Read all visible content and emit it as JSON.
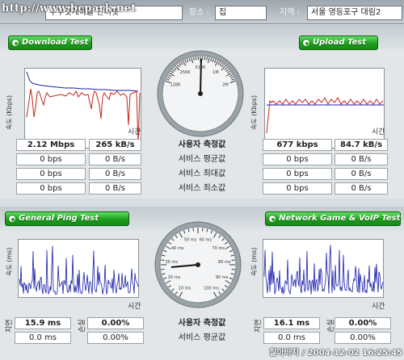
{
  "watermark": "http://www.bcpark.net",
  "topbar": {
    "service_value": "주무엇게하을 인터넷",
    "location_label": "장소 :",
    "location_value": "집",
    "region_label": "지역 :",
    "region_value": "서울 영등포구 대림2"
  },
  "download": {
    "title": "Download Test",
    "y_axis": "속도 (Kbps)",
    "x_axis": "시간",
    "rows": [
      [
        "2.12 Mbps",
        "265 kB/s"
      ],
      [
        "0 bps",
        "0 B/s"
      ],
      [
        "0 bps",
        "0 B/s"
      ],
      [
        "0 bps",
        "0 B/s"
      ]
    ]
  },
  "upload": {
    "title": "Upload Test",
    "y_axis": "속도 (Kbps)",
    "x_axis": "시간",
    "rows": [
      [
        "677 kbps",
        "84.7 kB/s"
      ],
      [
        "0 bps",
        "0 B/s"
      ],
      [
        "0 bps",
        "0 B/s"
      ],
      [
        "0 bps",
        "0 B/s"
      ]
    ]
  },
  "center_top": {
    "labels": [
      "사용자 측정값",
      "서비스 평균값",
      "서비스 최대값",
      "서비스 최소값"
    ]
  },
  "ping": {
    "title": "General Ping Test",
    "y_axis": "속도 (ms)",
    "x_axis": "시간",
    "side_label_left": "지연",
    "side_label_right": "손실",
    "rows": [
      [
        "15.9 ms",
        "0.00%"
      ],
      [
        "0.0 ms",
        "0.00%"
      ]
    ]
  },
  "game": {
    "title": "Network Game & VoIP Test",
    "y_axis": "속도 (ms)",
    "x_axis": "시간",
    "side_label_left": "지연",
    "side_label_right": "손실",
    "rows": [
      [
        "16.1 ms",
        "0.00%"
      ],
      [
        "0.0 ms",
        "0.00%"
      ]
    ]
  },
  "center_bottom": {
    "labels": [
      "사용자 측정값",
      "서비스 평균값"
    ]
  },
  "gauge_top": {
    "tick_labels": [
      "128K",
      "256K",
      "512K",
      "1M",
      "2M"
    ]
  },
  "gauge_bottom": {
    "tick_labels": [
      "10 ms",
      "20 ms",
      "30 ms",
      "40 ms",
      "50 ms",
      "60 ms",
      "70 ms",
      "80 ms",
      "90 ms",
      "100 ms"
    ]
  },
  "footer": {
    "timestamp": "찰아바지 / 2004-12-02 16:25:45"
  },
  "colors": {
    "green_button": "#1e9d1e",
    "series_red": "#c0281c",
    "series_blue": "#1a1fa8",
    "panel_bg": "#e2e6e8"
  }
}
